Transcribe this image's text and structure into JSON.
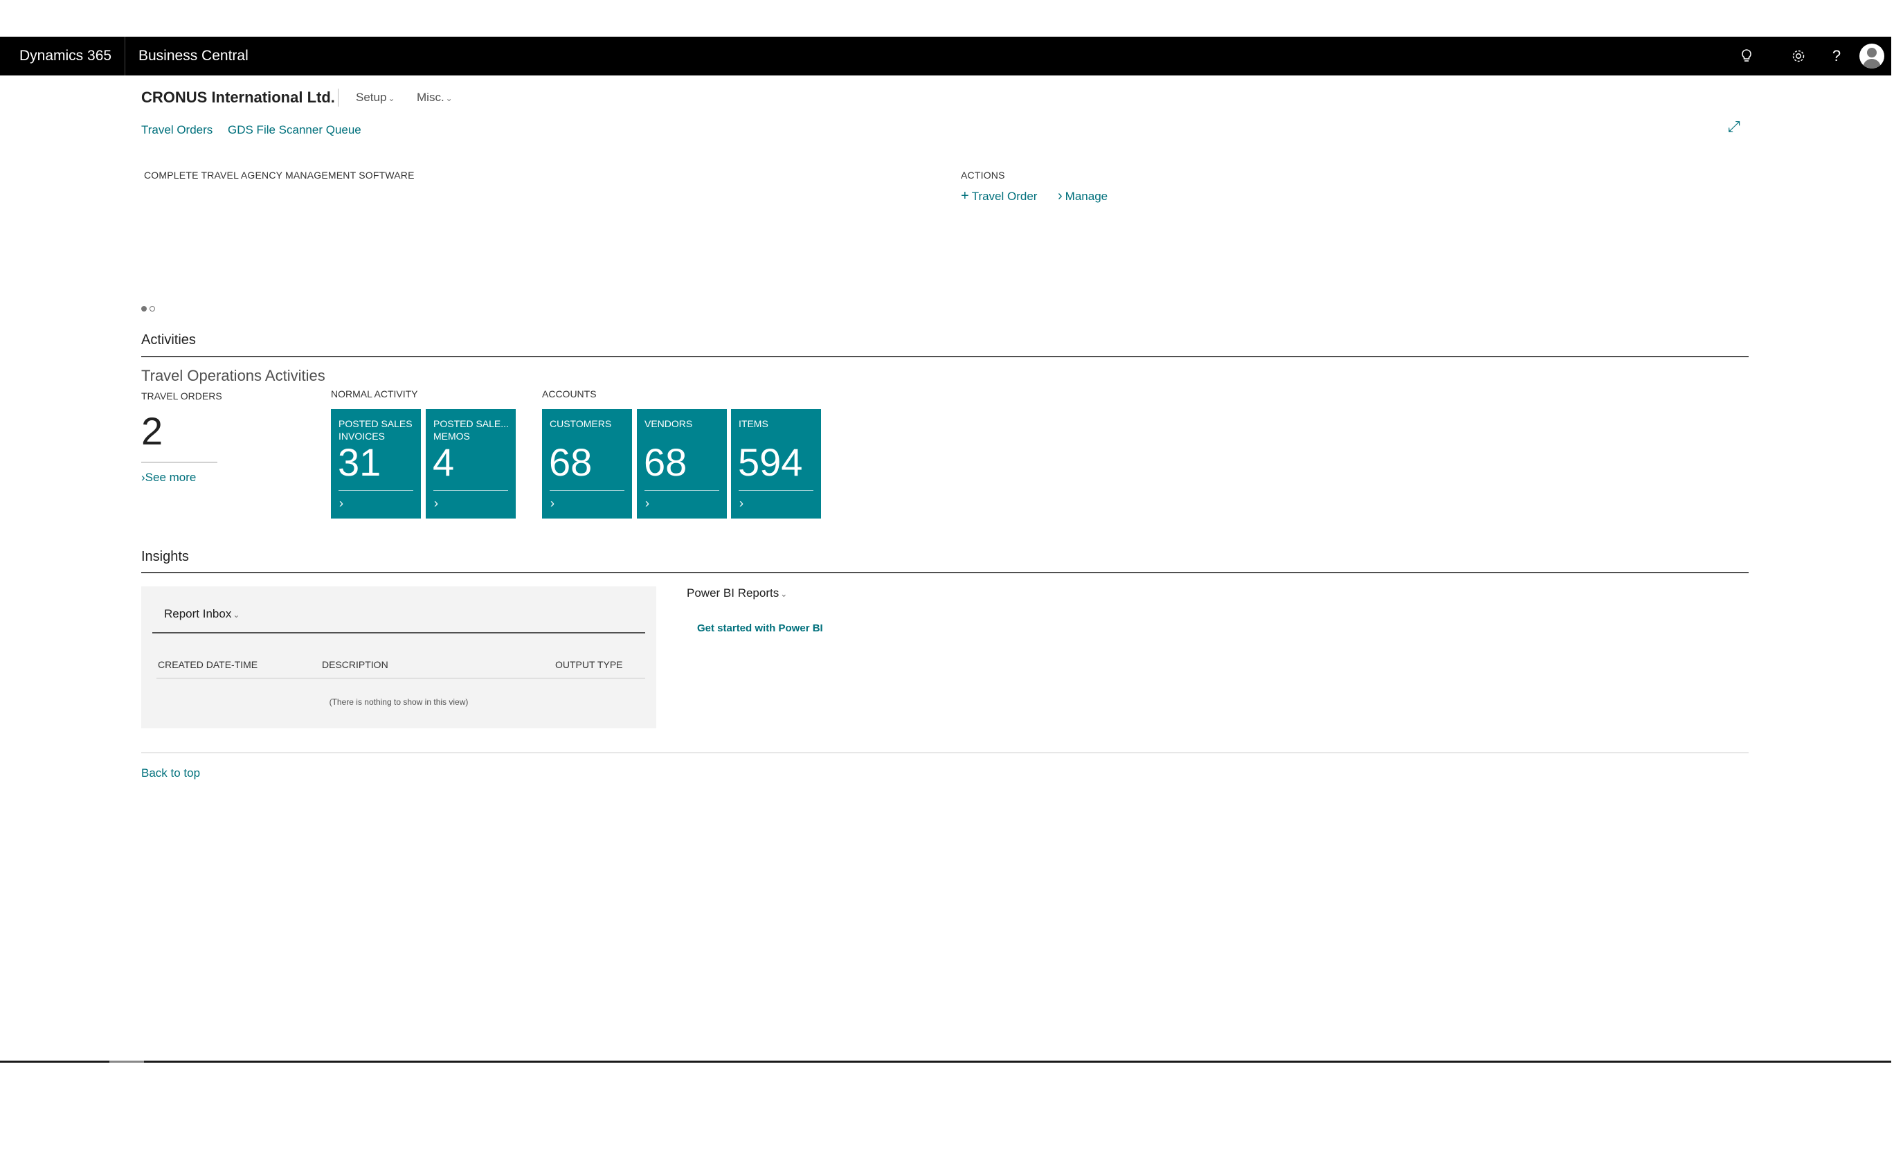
{
  "topbar": {
    "brand": "Dynamics 365",
    "app": "Business Central",
    "icons": [
      "lightbulb-icon",
      "gear-icon",
      "help-icon",
      "user-avatar"
    ]
  },
  "header": {
    "company": "CRONUS International Ltd.",
    "menus": [
      "Setup",
      "Misc."
    ],
    "nav_links": [
      "Travel Orders",
      "GDS File Scanner Queue"
    ]
  },
  "headline": {
    "caption": "COMPLETE TRAVEL AGENCY MANAGEMENT SOFTWARE"
  },
  "actions": {
    "caption": "ACTIONS",
    "items": [
      "Travel Order",
      "Manage"
    ]
  },
  "activities": {
    "title": "Activities",
    "group_title": "Travel Operations Activities",
    "travel_orders": {
      "label": "TRAVEL ORDERS",
      "value": "2",
      "see_more": "See more"
    },
    "normal_activity": {
      "label": "NORMAL ACTIVITY",
      "tiles": [
        {
          "label": "POSTED SALES INVOICES",
          "value": "31"
        },
        {
          "label": "POSTED SALE... MEMOS",
          "value": "4"
        }
      ]
    },
    "accounts": {
      "label": "ACCOUNTS",
      "tiles": [
        {
          "label": "CUSTOMERS",
          "value": "68"
        },
        {
          "label": "VENDORS",
          "value": "68"
        },
        {
          "label": "ITEMS",
          "value": "594"
        }
      ]
    }
  },
  "insights": {
    "title": "Insights",
    "report_inbox": {
      "title": "Report Inbox",
      "columns": [
        "CREATED DATE-TIME",
        "DESCRIPTION",
        "OUTPUT TYPE"
      ],
      "empty": "(There is nothing to show in this view)"
    },
    "power_bi": {
      "title": "Power BI Reports",
      "link": "Get started with Power BI"
    }
  },
  "footer": {
    "back_to_top": "Back to top"
  },
  "colors": {
    "accent": "#00707c",
    "tile": "#00838f",
    "topbar": "#000000"
  }
}
